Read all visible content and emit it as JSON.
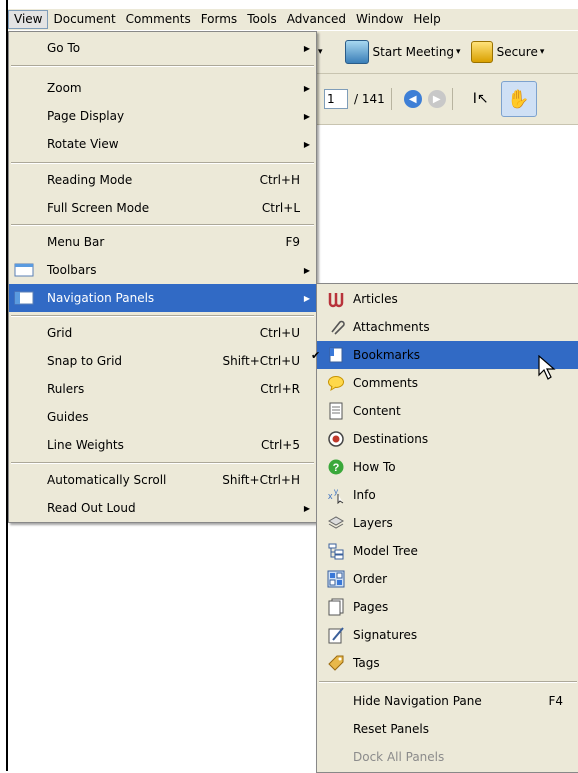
{
  "menubar": {
    "items": [
      "View",
      "Document",
      "Comments",
      "Forms",
      "Tools",
      "Advanced",
      "Window",
      "Help"
    ]
  },
  "toolbar": {
    "start_meeting": "Start Meeting",
    "secure": "Secure",
    "page_current": "1",
    "page_total": "/ 141"
  },
  "view_menu": {
    "go_to": "Go To",
    "zoom": "Zoom",
    "page_display": "Page Display",
    "rotate_view": "Rotate View",
    "reading_mode": "Reading Mode",
    "reading_mode_sc": "Ctrl+H",
    "full_screen": "Full Screen Mode",
    "full_screen_sc": "Ctrl+L",
    "menu_bar": "Menu Bar",
    "menu_bar_sc": "F9",
    "toolbars": "Toolbars",
    "navigation_panels": "Navigation Panels",
    "grid": "Grid",
    "grid_sc": "Ctrl+U",
    "snap_to_grid": "Snap to Grid",
    "snap_to_grid_sc": "Shift+Ctrl+U",
    "rulers": "Rulers",
    "rulers_sc": "Ctrl+R",
    "guides": "Guides",
    "line_weights": "Line Weights",
    "line_weights_sc": "Ctrl+5",
    "auto_scroll": "Automatically Scroll",
    "auto_scroll_sc": "Shift+Ctrl+H",
    "read_out_loud": "Read Out Loud"
  },
  "nav_menu": {
    "items": [
      "Articles",
      "Attachments",
      "Bookmarks",
      "Comments",
      "Content",
      "Destinations",
      "How To",
      "Info",
      "Layers",
      "Model Tree",
      "Order",
      "Pages",
      "Signatures",
      "Tags"
    ],
    "hide_pane": "Hide Navigation Pane",
    "hide_pane_sc": "F4",
    "reset_panels": "Reset Panels",
    "dock_all": "Dock All Panels"
  }
}
